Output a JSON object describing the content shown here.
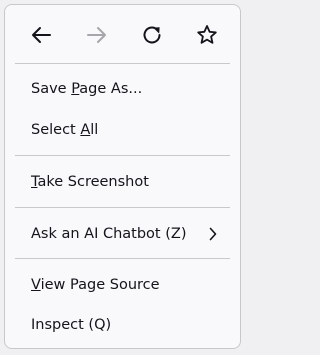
{
  "nav": {
    "back_icon": "arrow-left-icon",
    "forward_icon": "arrow-right-icon",
    "reload_icon": "reload-icon",
    "bookmark_icon": "star-icon"
  },
  "menu": {
    "items": [
      {
        "label_before": "Save ",
        "label_key": "P",
        "label_after": "age As..."
      },
      {
        "label_before": "Select ",
        "label_key": "A",
        "label_after": "ll"
      },
      {
        "label_before": "",
        "label_key": "T",
        "label_after": "ake Screenshot"
      },
      {
        "label": "Ask an AI Chatbot (Z)",
        "submenu_icon": "chevron-right-icon"
      },
      {
        "label_before": "",
        "label_key": "V",
        "label_after": "iew Page Source"
      },
      {
        "label": "Inspect (Q)"
      }
    ]
  },
  "colors": {
    "text": "#15141a",
    "disabled": "#a6a6ab",
    "background": "#f9f9fb",
    "separator": "#c9c9cd"
  }
}
